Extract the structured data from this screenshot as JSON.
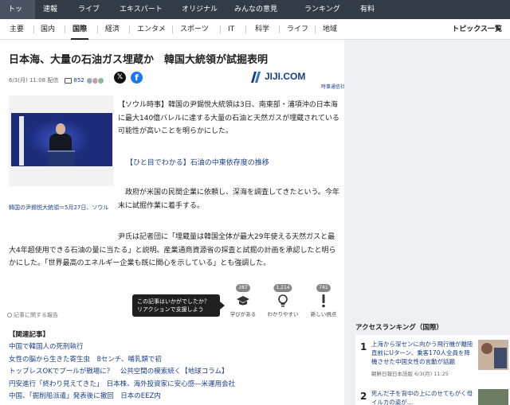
{
  "top_nav": [
    "トップ",
    "速報",
    "ライブ",
    "エキスパート",
    "オリジナル",
    "みんなの意見",
    "ランキング",
    "有料"
  ],
  "sub_nav": [
    "主要",
    "国内",
    "国際",
    "経済",
    "エンタメ",
    "スポーツ",
    "IT",
    "科学",
    "ライフ",
    "地域"
  ],
  "topics_label": "トピックス一覧",
  "article": {
    "title": "日本海、大量の石油ガス埋蔵か　韓国大統領が試掘表明",
    "date": "6/3(月) 11:08 配信",
    "comment_count": "852",
    "publisher_name": "JIJI.COM",
    "publisher_sub": "時事通信社",
    "photo_caption": "韓国の尹錫悦大統領＝5月27日、ソウル",
    "p1": "【ソウル時事】韓国の尹錫悦大統領は3日、南東部・浦項沖の日本海に最大140億バレルに達する大量の石油と天然ガスが埋蔵されている可能性が高いことを明らかにした。",
    "link": "【ひと目でわかる】石油の中東依存度の推移",
    "p2": "政府が米国の民間企業に依頼し、深海を調査してきたという。今年末に試掘作業に着手する。",
    "p3": "尹氏は記者団に「埋蔵量は韓国全体が最大29年使える天然ガスと最大4年超使用できる石油の量に当たる」と説明。産業通商資源省の探査と試掘の計画を承認したと明らかにした。「世界最高のエネルギー企業も既に関心を示している」とも強調した。"
  },
  "reactions": {
    "report_label": "記事に関する報告",
    "tooltip_line1": "この記事はいかがでしたか？",
    "tooltip_line2": "リアクションで支援しよう",
    "items": [
      {
        "count": "287",
        "label": "学びがある",
        "icon": "graduation-cap-icon"
      },
      {
        "count": "1,214",
        "label": "わかりやすい",
        "icon": "lightbulb-icon"
      },
      {
        "count": "741",
        "label": "新しい視点",
        "icon": "exclamation-icon"
      }
    ]
  },
  "related": {
    "heading": "【関連記事】",
    "items": [
      "中国で韓国人の死刑執行",
      "女性の脳から生きた寄生虫　8センチ、哺乳類で初",
      "トップレスOKでプールが戦場に？　公共空間の模索続く【地球コラム】",
      "円安進行「終わり見えてきた」　日本株、海外投資家に安心感―米運用会社",
      "中国、「掘削船派遣」発表後に撤回　日本のEEZ内"
    ]
  },
  "ranking": {
    "heading": "アクセスランキング（国際）",
    "items": [
      {
        "num": "1",
        "text": "上海から深センに向かう飛行機が離陸直前にUターン、乗客170人全員を降機させた中国女性の言動が話題",
        "source": "朝鮮日報日本語版 6/3(月) 11:25"
      },
      {
        "num": "2",
        "text": "死んだ子を背中の上にのせてもがく母イルカの姿が…",
        "source": ""
      }
    ]
  }
}
